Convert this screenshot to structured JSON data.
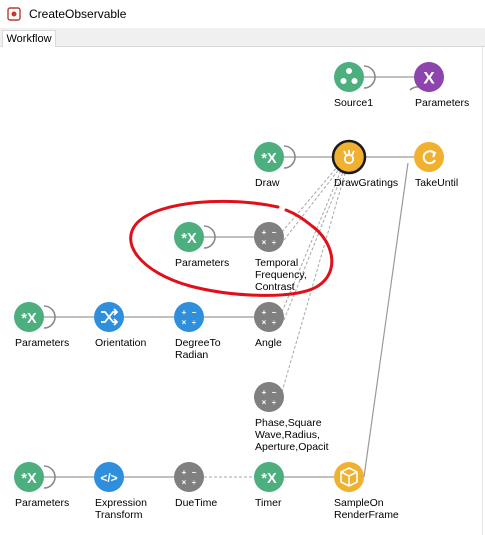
{
  "window": {
    "title": "CreateObservable"
  },
  "tabs": [
    {
      "label": "Workflow"
    }
  ],
  "nodes": {
    "source1": {
      "label": "Source1",
      "icon": "source-icon",
      "color": "#4caf7d"
    },
    "parameters_top": {
      "label": "Parameters",
      "icon": "x-icon",
      "color": "#8e44ad"
    },
    "draw": {
      "label": "Draw",
      "icon": "star-x-icon",
      "color": "#4caf7d"
    },
    "drawgratings": {
      "label": "DrawGratings",
      "icon": "fire-icon",
      "color": "#f0b030"
    },
    "takeuntil": {
      "label": "TakeUntil",
      "icon": "refresh-icon",
      "color": "#f0b030"
    },
    "parameters_mid": {
      "label": "Parameters",
      "icon": "star-x-icon",
      "color": "#4caf7d"
    },
    "temporal": {
      "label": "Temporal\nFrequency,\nContrast",
      "icon": "math-icon",
      "color": "#808080"
    },
    "parameters_left": {
      "label": "Parameters",
      "icon": "star-x-icon",
      "color": "#4caf7d"
    },
    "orientation": {
      "label": "Orientation",
      "icon": "shuffle-icon",
      "color": "#2f8fdd"
    },
    "degreetoradian": {
      "label": "DegreeTo\nRadian",
      "icon": "math-icon",
      "color": "#2f8fdd"
    },
    "angle": {
      "label": "Angle",
      "icon": "math-icon",
      "color": "#808080"
    },
    "phase": {
      "label": "Phase,Square\nWave,Radius,\nAperture,Opacit",
      "icon": "math-icon",
      "color": "#808080"
    },
    "parameters_bottom": {
      "label": "Parameters",
      "icon": "star-x-icon",
      "color": "#4caf7d"
    },
    "expression": {
      "label": "Expression\nTransform",
      "icon": "code-icon",
      "color": "#2f8fdd"
    },
    "duetime": {
      "label": "DueTime",
      "icon": "math-icon",
      "color": "#808080"
    },
    "timer": {
      "label": "Timer",
      "icon": "star-x-icon",
      "color": "#4caf7d"
    },
    "sampleon": {
      "label": "SampleOn\nRenderFrame",
      "icon": "cube-icon",
      "color": "#f0b030"
    }
  },
  "colors": {
    "annotation_circle": "#e0101a",
    "edge": "#9a9a9a",
    "selected_ring": "#1a1a1a"
  }
}
